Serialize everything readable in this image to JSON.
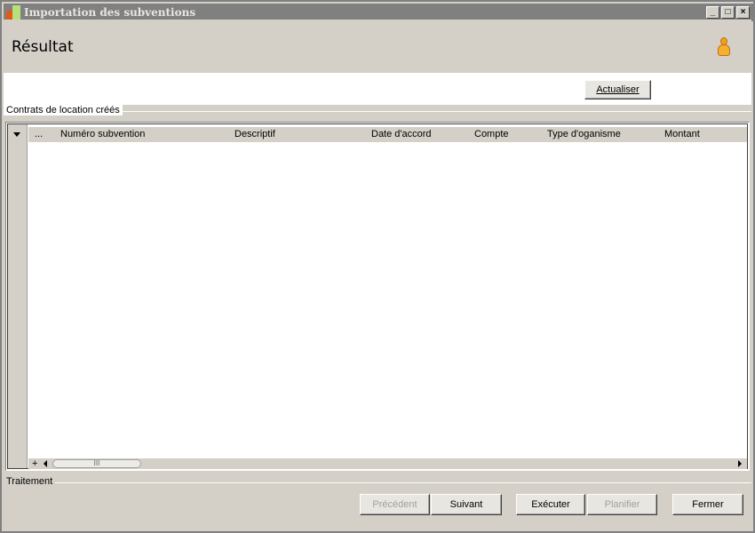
{
  "window": {
    "title": "Importation des subventions",
    "controls": {
      "minimize": "_",
      "maximize": "□",
      "close": "×"
    }
  },
  "header": {
    "title": "Résultat",
    "user_icon": "user-icon"
  },
  "toolbar": {
    "refresh_label": "Actualiser"
  },
  "contracts": {
    "group_label": "Contrats de location créés",
    "columns": [
      "...",
      "Numéro subvention",
      "Descriptif",
      "Date d'accord",
      "Compte",
      "Type d'oganisme",
      "Montant"
    ],
    "rows": [],
    "add_label": "+",
    "scroll_thumb_grip": "III"
  },
  "processing": {
    "group_label": "Traitement"
  },
  "footer": {
    "previous_label": "Précédent",
    "next_label": "Suivant",
    "execute_label": "Exécuter",
    "schedule_label": "Planifier",
    "close_label": "Fermer"
  }
}
